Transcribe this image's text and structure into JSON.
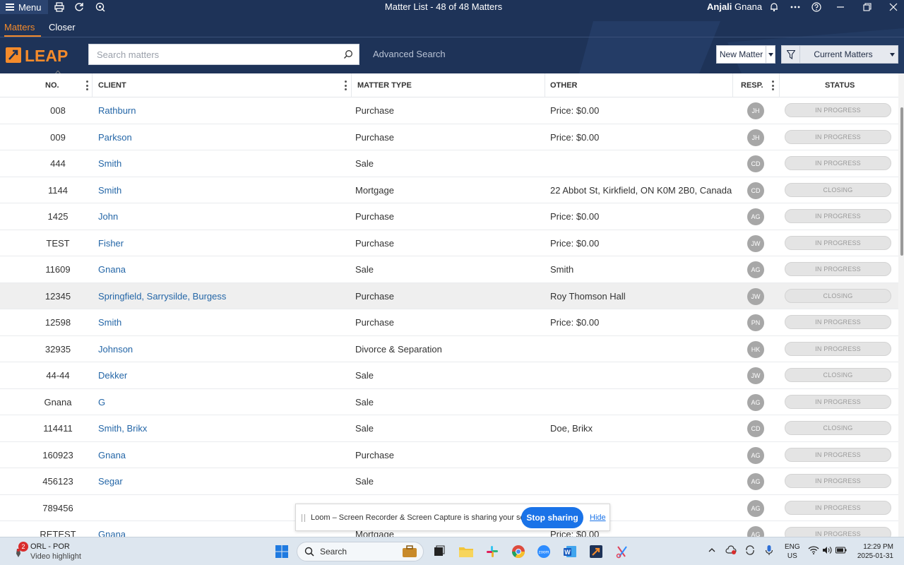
{
  "app": {
    "menu_label": "Menu",
    "window_title": "Matter List - 48 of 48 Matters",
    "user_first": "Anjali",
    "user_last": " Gnana"
  },
  "tabs": [
    {
      "label": "Matters",
      "active": true
    },
    {
      "label": "Closer",
      "active": false
    }
  ],
  "toolbar": {
    "search_placeholder": "Search matters",
    "advanced_search": "Advanced Search",
    "new_matter": "New Matter",
    "filter_label": "Current Matters"
  },
  "columns": {
    "no": "NO.",
    "client": "CLIENT",
    "matter_type": "MATTER TYPE",
    "other": "OTHER",
    "resp": "RESP.",
    "status": "STATUS"
  },
  "rows": [
    {
      "no": "008",
      "client": "Rathburn",
      "type": "Purchase",
      "other": "Price: $0.00",
      "resp": "JH",
      "status": "IN PROGRESS"
    },
    {
      "no": "009",
      "client": "Parkson",
      "type": "Purchase",
      "other": "Price: $0.00",
      "resp": "JH",
      "status": "IN PROGRESS"
    },
    {
      "no": "444",
      "client": "Smith",
      "type": "Sale",
      "other": "",
      "resp": "CD",
      "status": "IN PROGRESS"
    },
    {
      "no": "1144",
      "client": "Smith",
      "type": "Mortgage",
      "other": "22 Abbot St, Kirkfield, ON K0M 2B0, Canada",
      "resp": "CD",
      "status": "CLOSING"
    },
    {
      "no": "1425",
      "client": "John",
      "type": "Purchase",
      "other": "Price: $0.00",
      "resp": "AG",
      "status": "IN PROGRESS"
    },
    {
      "no": "TEST",
      "client": "Fisher",
      "type": "Purchase",
      "other": "Price: $0.00",
      "resp": "JW",
      "status": "IN PROGRESS"
    },
    {
      "no": "11609",
      "client": "Gnana",
      "type": "Sale",
      "other": "Smith",
      "resp": "AG",
      "status": "IN PROGRESS"
    },
    {
      "no": "12345",
      "client": "Springfield, Sarrysilde, Burgess",
      "type": "Purchase",
      "other": "Roy Thomson Hall",
      "resp": "JW",
      "status": "CLOSING",
      "highlighted": true
    },
    {
      "no": "12598",
      "client": "Smith",
      "type": "Purchase",
      "other": "Price: $0.00",
      "resp": "PN",
      "status": "IN PROGRESS"
    },
    {
      "no": "32935",
      "client": "Johnson",
      "type": "Divorce & Separation",
      "other": "",
      "resp": "HK",
      "status": "IN PROGRESS"
    },
    {
      "no": "44-44",
      "client": "Dekker",
      "type": "Sale",
      "other": "",
      "resp": "JW",
      "status": "CLOSING"
    },
    {
      "no": "Gnana",
      "client": "G",
      "type": "Sale",
      "other": "",
      "resp": "AG",
      "status": "IN PROGRESS"
    },
    {
      "no": "114411",
      "client": "Smith, Brikx",
      "type": "Sale",
      "other": "Doe, Brikx",
      "resp": "CD",
      "status": "CLOSING"
    },
    {
      "no": "160923",
      "client": "Gnana",
      "type": "Purchase",
      "other": "",
      "resp": "AG",
      "status": "IN PROGRESS"
    },
    {
      "no": "456123",
      "client": "Segar",
      "type": "Sale",
      "other": "",
      "resp": "AG",
      "status": "IN PROGRESS"
    },
    {
      "no": "789456",
      "client": "",
      "type": "",
      "other": "",
      "resp": "AG",
      "status": "IN PROGRESS"
    },
    {
      "no": "RETEST",
      "client": "Gnana",
      "type": "Mortgage",
      "other": "Price: $0.00",
      "resp": "AG",
      "status": "IN PROGRESS"
    }
  ],
  "loom": {
    "message": "Loom – Screen Recorder & Screen Capture is sharing your screen.",
    "stop": "Stop sharing",
    "hide": "Hide"
  },
  "taskbar": {
    "notif_count": "2",
    "weather_line1": "ORL - POR",
    "weather_line2": "Video highlight",
    "search_label": "Search",
    "lang_line1": "ENG",
    "lang_line2": "US",
    "time": "12:29 PM",
    "date": "2025-01-31"
  },
  "colors": {
    "header_bg": "#1e3358",
    "accent_orange": "#f48b2b",
    "link_blue": "#2466a7",
    "stop_blue": "#1a73e8"
  }
}
